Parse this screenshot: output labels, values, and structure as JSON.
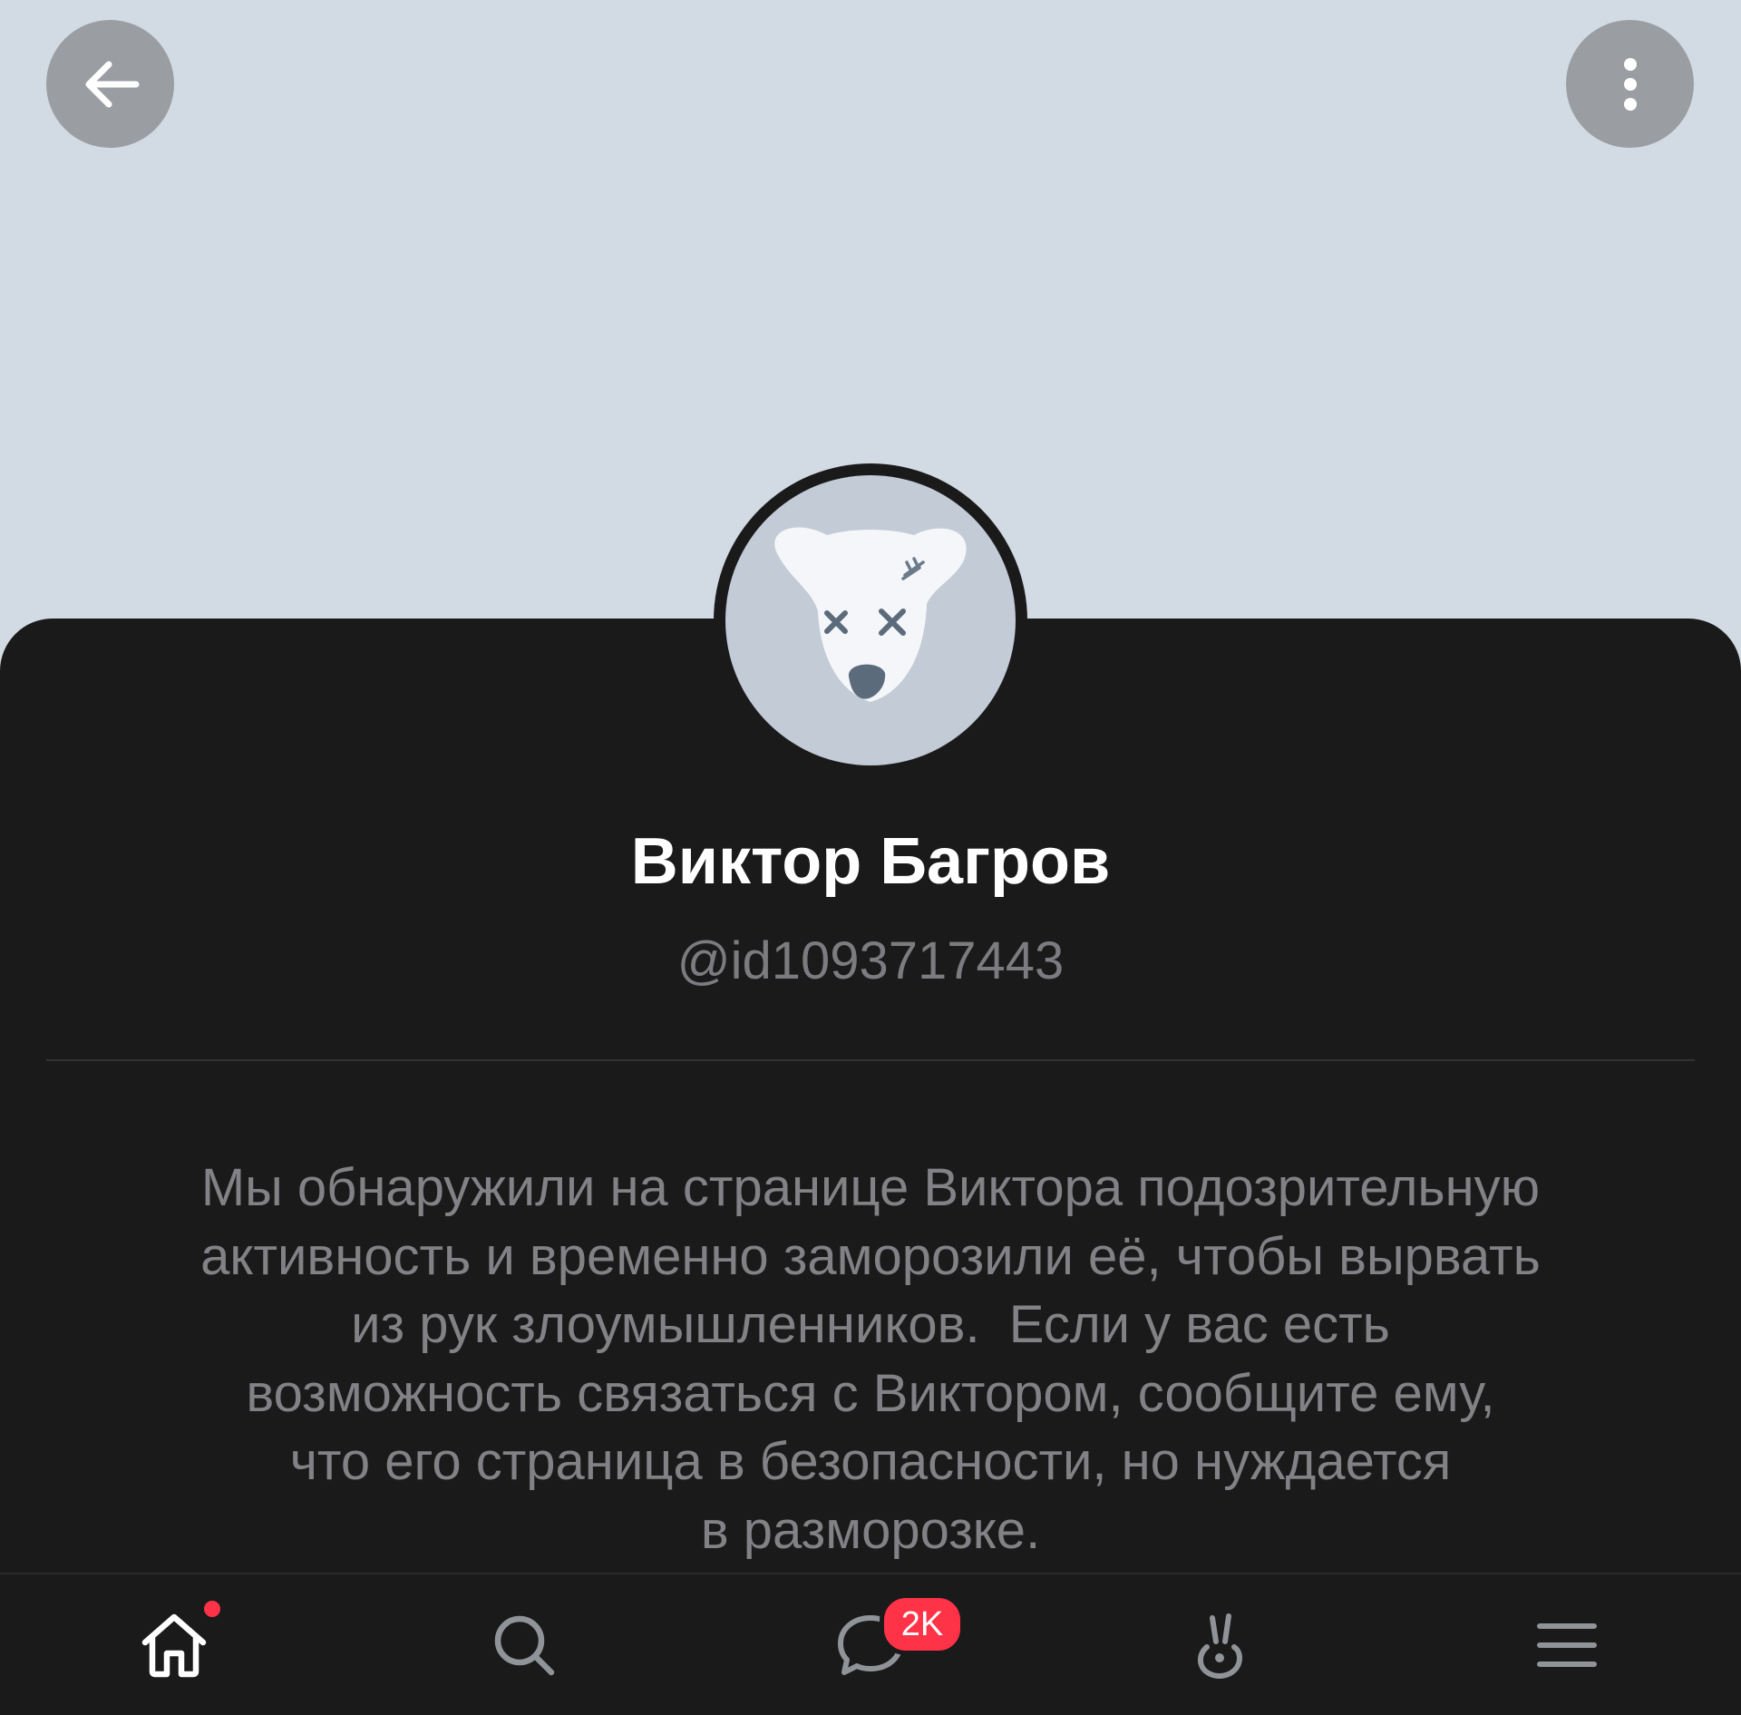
{
  "header": {
    "back_icon": "arrow-left-icon",
    "more_icon": "more-vertical-icon",
    "cover_color": "#d2dbe3"
  },
  "profile": {
    "avatar": "deactivated-dog-avatar",
    "name": "Виктор Багров",
    "handle": "@id1093717443",
    "notice_lines": [
      "Мы обнаружили на странице Виктора подозрительную",
      "активность и временно заморозили её, чтобы вырвать",
      "из рук злоумышленников.  Если у вас есть",
      "возможность связаться с Виктором, сообщите ему,",
      "что его страница в безопасности, но нуждается",
      "в разморозке."
    ]
  },
  "tabbar": {
    "items": [
      {
        "icon": "home-icon",
        "has_dot": true
      },
      {
        "icon": "search-icon"
      },
      {
        "icon": "messages-icon",
        "badge": "2K"
      },
      {
        "icon": "clips-icon"
      },
      {
        "icon": "menu-icon"
      }
    ],
    "accent_color": "#ff3347"
  }
}
